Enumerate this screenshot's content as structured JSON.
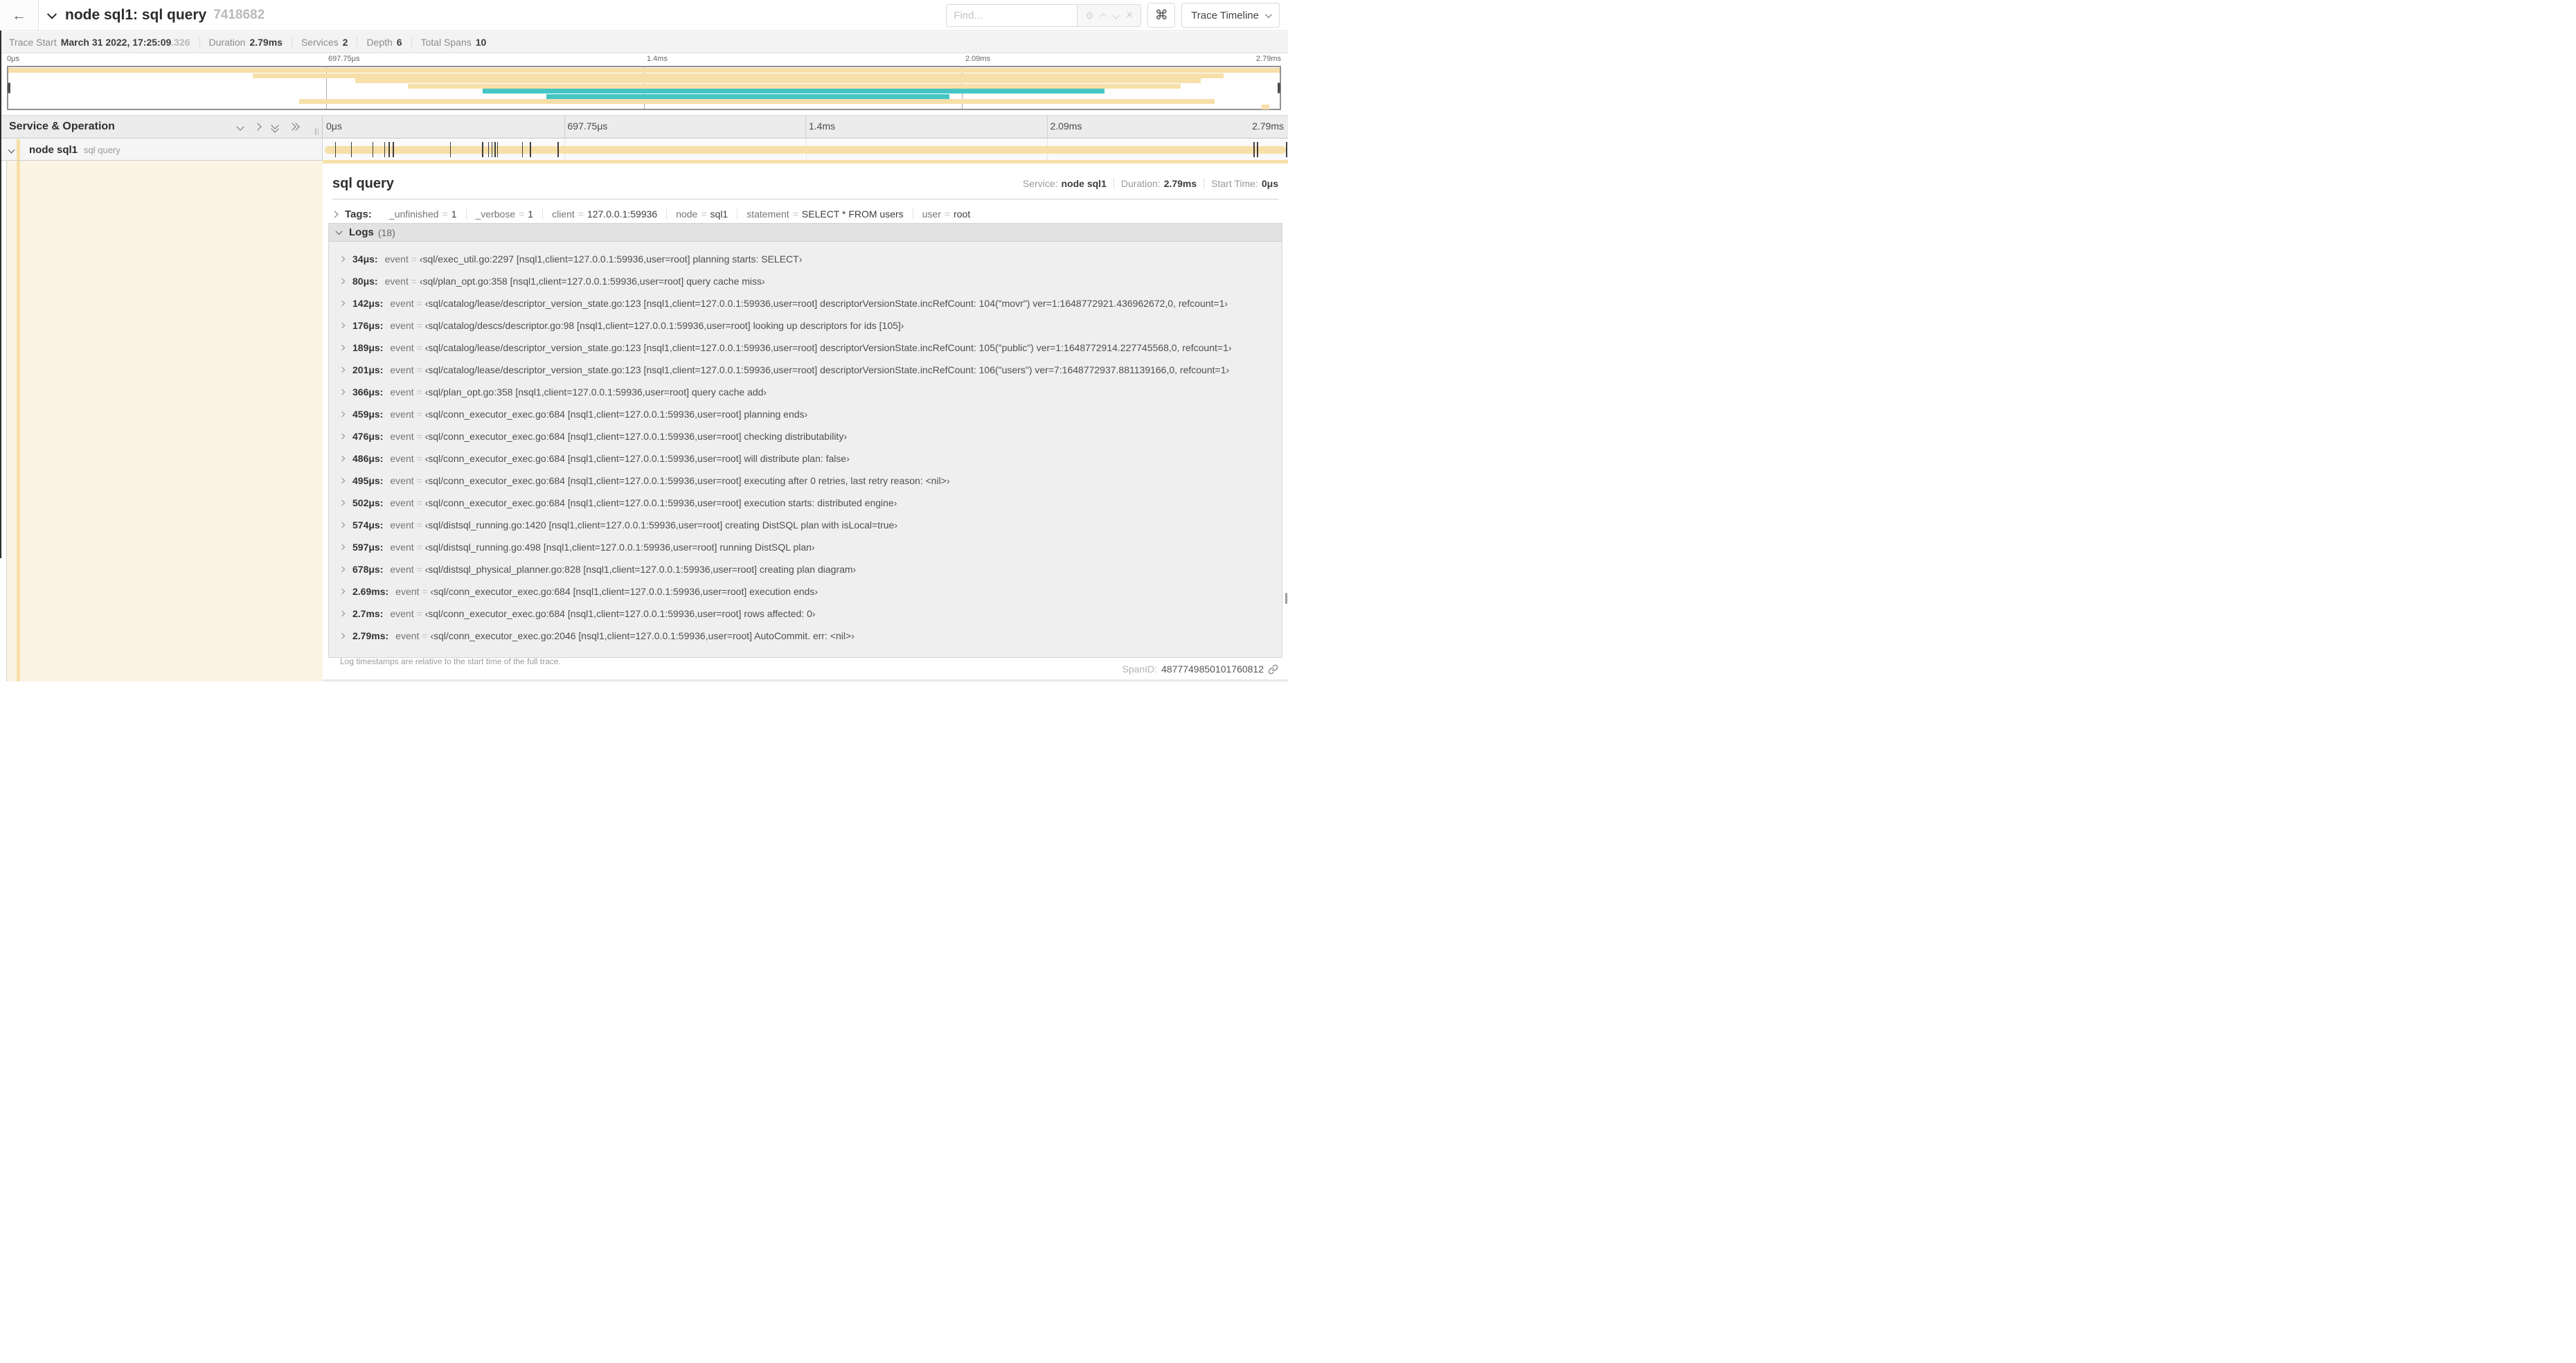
{
  "header": {
    "back_icon": "←",
    "title": "node sql1: sql query",
    "trace_id": "7418682",
    "find_placeholder": "Find...",
    "shortcut_key": "⌘",
    "view_selector": "Trace Timeline",
    "close_icon": "✕"
  },
  "stats": {
    "items": [
      {
        "label": "Trace Start",
        "value": "March 31 2022, 17:25:09",
        "suffix": ".326"
      },
      {
        "label": "Duration",
        "value": "2.79ms",
        "suffix": ""
      },
      {
        "label": "Services",
        "value": "2",
        "suffix": ""
      },
      {
        "label": "Depth",
        "value": "6",
        "suffix": ""
      },
      {
        "label": "Total Spans",
        "value": "10",
        "suffix": ""
      }
    ]
  },
  "timeline": {
    "ticks": [
      "0μs",
      "697.75μs",
      "1.4ms",
      "2.09ms",
      "2.79ms"
    ],
    "tick_positions_pct": [
      0,
      25,
      50,
      75,
      100
    ],
    "log_marker_positions_pct": [
      1.22,
      2.87,
      5.09,
      6.31,
      6.77,
      7.2,
      13.12,
      16.45,
      17.06,
      17.42,
      17.74,
      17.99,
      20.57,
      21.4,
      24.3,
      96.42,
      96.77,
      99.8
    ]
  },
  "minimap": {
    "spans": [
      {
        "row": 0,
        "start_pct": 0,
        "end_pct": 100,
        "color": "tan"
      },
      {
        "row": 1,
        "start_pct": 19.2,
        "end_pct": 95.6,
        "color": "tan"
      },
      {
        "row": 2,
        "start_pct": 27.3,
        "end_pct": 93.8,
        "color": "tan"
      },
      {
        "row": 3,
        "start_pct": 31.4,
        "end_pct": 92.2,
        "color": "tan"
      },
      {
        "row": 4,
        "start_pct": 37.3,
        "end_pct": 86.2,
        "color": "teal"
      },
      {
        "row": 5,
        "start_pct": 42.3,
        "end_pct": 74.0,
        "color": "teal"
      },
      {
        "row": 6,
        "start_pct": 22.9,
        "end_pct": 94.9,
        "color": "tan"
      },
      {
        "row": 7,
        "start_pct": 98.6,
        "end_pct": 99.2,
        "color": "tan"
      }
    ]
  },
  "colors": {
    "tan": "#f6dfa9",
    "teal": "#45c5c4",
    "cream": "#fbf4e5"
  },
  "tree": {
    "header": "Service & Operation",
    "row": {
      "service": "node sql1",
      "operation": "sql query"
    }
  },
  "detail": {
    "title": "sql query",
    "meta": [
      {
        "label": "Service:",
        "value": "node sql1"
      },
      {
        "label": "Duration:",
        "value": "2.79ms"
      },
      {
        "label": "Start Time:",
        "value": "0μs"
      }
    ],
    "tags": {
      "label": "Tags:",
      "items": [
        {
          "key": "_unfinished",
          "value": "1"
        },
        {
          "key": "_verbose",
          "value": "1"
        },
        {
          "key": "client",
          "value": "127.0.0.1:59936"
        },
        {
          "key": "node",
          "value": "sql1"
        },
        {
          "key": "statement",
          "value": "SELECT * FROM users"
        },
        {
          "key": "user",
          "value": "root"
        }
      ]
    },
    "logs": {
      "label": "Logs",
      "count": "(18)",
      "key": "event",
      "rows": [
        {
          "time": "34μs:",
          "value": "‹sql/exec_util.go:2297 [nsql1,client=127.0.0.1:59936,user=root] planning starts: SELECT›"
        },
        {
          "time": "80μs:",
          "value": "‹sql/plan_opt.go:358 [nsql1,client=127.0.0.1:59936,user=root] query cache miss›"
        },
        {
          "time": "142μs:",
          "value": "‹sql/catalog/lease/descriptor_version_state.go:123 [nsql1,client=127.0.0.1:59936,user=root] descriptorVersionState.incRefCount: 104(\"movr\") ver=1:1648772921.436962672,0, refcount=1›"
        },
        {
          "time": "176μs:",
          "value": "‹sql/catalog/descs/descriptor.go:98 [nsql1,client=127.0.0.1:59936,user=root] looking up descriptors for ids [105]›"
        },
        {
          "time": "189μs:",
          "value": "‹sql/catalog/lease/descriptor_version_state.go:123 [nsql1,client=127.0.0.1:59936,user=root] descriptorVersionState.incRefCount: 105(\"public\") ver=1:1648772914.227745568,0, refcount=1›"
        },
        {
          "time": "201μs:",
          "value": "‹sql/catalog/lease/descriptor_version_state.go:123 [nsql1,client=127.0.0.1:59936,user=root] descriptorVersionState.incRefCount: 106(\"users\") ver=7:1648772937.881139166,0, refcount=1›"
        },
        {
          "time": "366μs:",
          "value": "‹sql/plan_opt.go:358 [nsql1,client=127.0.0.1:59936,user=root] query cache add›"
        },
        {
          "time": "459μs:",
          "value": "‹sql/conn_executor_exec.go:684 [nsql1,client=127.0.0.1:59936,user=root] planning ends›"
        },
        {
          "time": "476μs:",
          "value": "‹sql/conn_executor_exec.go:684 [nsql1,client=127.0.0.1:59936,user=root] checking distributability›"
        },
        {
          "time": "486μs:",
          "value": "‹sql/conn_executor_exec.go:684 [nsql1,client=127.0.0.1:59936,user=root] will distribute plan: false›"
        },
        {
          "time": "495μs:",
          "value": "‹sql/conn_executor_exec.go:684 [nsql1,client=127.0.0.1:59936,user=root] executing after 0 retries, last retry reason: <nil>›"
        },
        {
          "time": "502μs:",
          "value": "‹sql/conn_executor_exec.go:684 [nsql1,client=127.0.0.1:59936,user=root] execution starts: distributed engine›"
        },
        {
          "time": "574μs:",
          "value": "‹sql/distsql_running.go:1420 [nsql1,client=127.0.0.1:59936,user=root] creating DistSQL plan with isLocal=true›"
        },
        {
          "time": "597μs:",
          "value": "‹sql/distsql_running.go:498 [nsql1,client=127.0.0.1:59936,user=root] running DistSQL plan›"
        },
        {
          "time": "678μs:",
          "value": "‹sql/distsql_physical_planner.go:828 [nsql1,client=127.0.0.1:59936,user=root] creating plan diagram›"
        },
        {
          "time": "2.69ms:",
          "value": "‹sql/conn_executor_exec.go:684 [nsql1,client=127.0.0.1:59936,user=root] execution ends›"
        },
        {
          "time": "2.7ms:",
          "value": "‹sql/conn_executor_exec.go:684 [nsql1,client=127.0.0.1:59936,user=root] rows affected: 0›"
        },
        {
          "time": "2.79ms:",
          "value": "‹sql/conn_executor_exec.go:2046 [nsql1,client=127.0.0.1:59936,user=root] AutoCommit. err: <nil>›"
        }
      ],
      "note": "Log timestamps are relative to the start time of the full trace."
    },
    "footer": {
      "label": "SpanID:",
      "value": "4877749850101760812"
    }
  }
}
